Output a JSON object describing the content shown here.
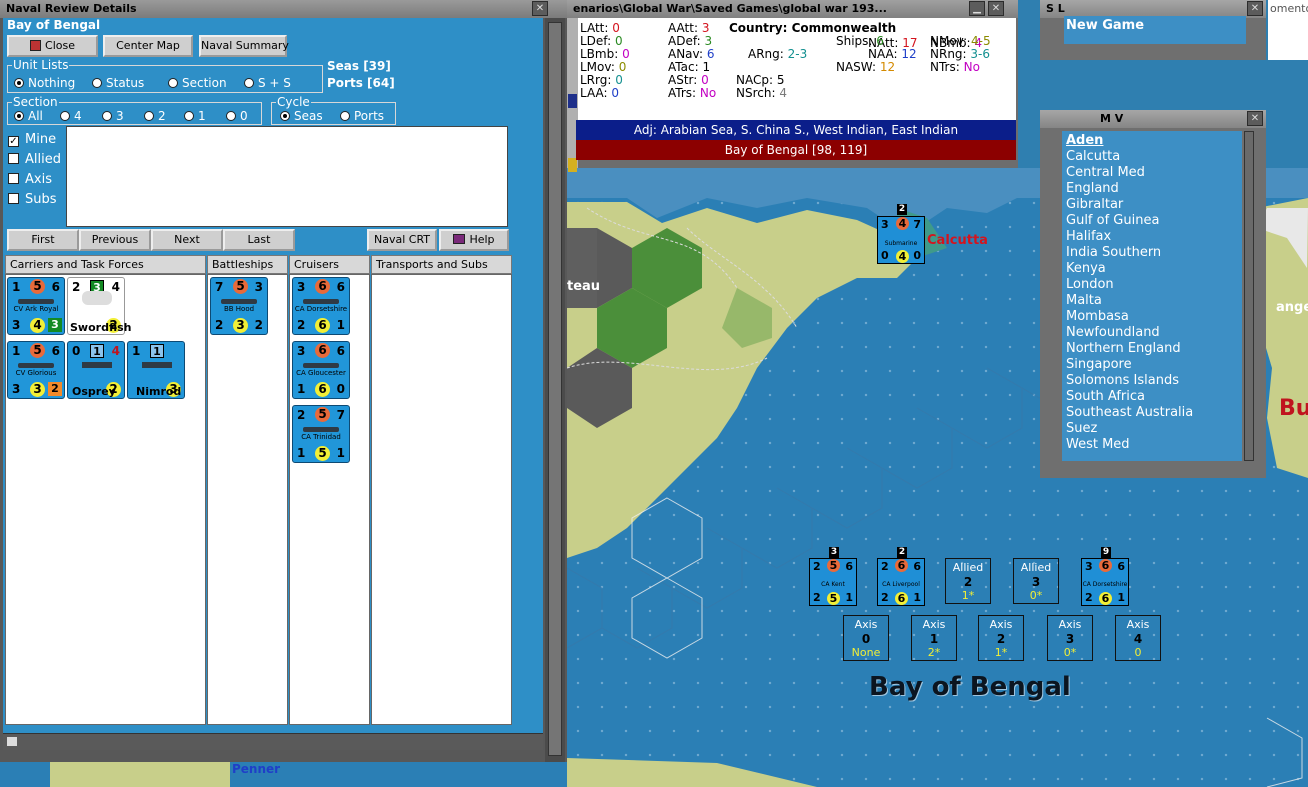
{
  "naval_review": {
    "title": "Naval Review Details",
    "sea_area": "Bay of Bengal",
    "buttons": {
      "close": "Close",
      "center_map": "Center Map",
      "naval_summary": "Naval Summary"
    },
    "seas": "Seas [39]",
    "ports": "Ports [64]",
    "unit_lists": {
      "title": "Unit Lists",
      "options": [
        "Nothing",
        "Status",
        "Section",
        "S + S"
      ],
      "selected": "Nothing"
    },
    "section": {
      "title": "Section",
      "options": [
        "All",
        "4",
        "3",
        "2",
        "1",
        "0"
      ],
      "selected": "All"
    },
    "cycle": {
      "title": "Cycle",
      "options": [
        "Seas",
        "Ports"
      ],
      "selected": "Seas"
    },
    "filters": [
      {
        "label": "Mine",
        "checked": true
      },
      {
        "label": "Allied",
        "checked": false
      },
      {
        "label": "Axis",
        "checked": false
      },
      {
        "label": "Subs",
        "checked": false
      }
    ],
    "nav": {
      "first": "First",
      "previous": "Previous",
      "next": "Next",
      "last": "Last",
      "naval_crt": "Naval CRT",
      "help": "Help"
    },
    "columns": [
      "Carriers and Task Forces",
      "Battleships",
      "Cruisers",
      "Transports and Subs"
    ],
    "carriers": [
      {
        "name": "CV Ark Royal",
        "tl": "1",
        "tc": "5",
        "tr": "6",
        "bl": "3",
        "bc": "4",
        "br": "3"
      },
      {
        "name": "CV Glorious",
        "tl": "1",
        "tc": "5",
        "tr": "6",
        "bl": "3",
        "bc": "3",
        "br": "2"
      }
    ],
    "aircraft": [
      {
        "label": "Swordfish",
        "tl": "2",
        "badge": "3",
        "tr": "4",
        "bc": "2"
      },
      {
        "label": "Osprey",
        "tl": "0",
        "badge": "1",
        "tr": "4",
        "bc": "2"
      },
      {
        "label": "Nimrod",
        "tl": "1",
        "badge": "1",
        "tr": "",
        "bc": "3"
      }
    ],
    "battleships": [
      {
        "name": "BB Hood",
        "tl": "7",
        "tc": "5",
        "tr": "3",
        "bl": "2",
        "bc": "3",
        "br": "2"
      }
    ],
    "cruisers": [
      {
        "name": "CA Dorsetshire",
        "tl": "3",
        "tc": "6",
        "tr": "6",
        "bl": "2",
        "bc": "6",
        "br": "1"
      },
      {
        "name": "CA Gloucester",
        "tl": "3",
        "tc": "6",
        "tr": "6",
        "bl": "1",
        "bc": "6",
        "br": "0"
      },
      {
        "name": "CA Trinidad",
        "tl": "2",
        "tc": "5",
        "tr": "7",
        "bl": "1",
        "bc": "5",
        "br": "1"
      }
    ]
  },
  "info_panel": {
    "title": "enarios\\Global War\\Saved Games\\global war 193...",
    "country": "Country: Commonwealth",
    "stats": [
      {
        "k": "LAtt:",
        "v": "0",
        "c": "#d4141e"
      },
      {
        "k": "AAtt:",
        "v": "3",
        "c": "#d4141e"
      },
      {
        "k": "NAtt:",
        "v": "17",
        "c": "#d4141e"
      },
      {
        "k": "NBmb:",
        "v": "4",
        "c": "#c200c2"
      },
      {
        "k": "LDef:",
        "v": "0",
        "c": "#2a8a22"
      },
      {
        "k": "ADef:",
        "v": "3",
        "c": "#2a8a22"
      },
      {
        "k": "Ships:",
        "v": "6",
        "c": "#2a8a22"
      },
      {
        "k": "NMov:",
        "v": "4-5",
        "c": "#8c8c00"
      },
      {
        "k": "LBmb:",
        "v": "0",
        "c": "#c200c2"
      },
      {
        "k": "ANav:",
        "v": "6",
        "c": "#1f3fc8"
      },
      {
        "k": "ARng:",
        "v": "2-3",
        "c": "#139090"
      },
      {
        "k": "NAA:",
        "v": "12",
        "c": "#1f3fc8"
      },
      {
        "k": "NRng:",
        "v": "3-6",
        "c": "#139090"
      },
      {
        "k": "LMov:",
        "v": "0",
        "c": "#8c8c00"
      },
      {
        "k": "ATac:",
        "v": "1",
        "c": "#000000"
      },
      {
        "k": "NASW:",
        "v": "12",
        "c": "#d48a00"
      },
      {
        "k": "NTrs:",
        "v": "No",
        "c": "#c200c2"
      },
      {
        "k": "LRrg:",
        "v": "0",
        "c": "#139090"
      },
      {
        "k": "AStr:",
        "v": "0",
        "c": "#c200c2"
      },
      {
        "k": "NACp:",
        "v": "5",
        "c": "#000000"
      },
      {
        "k": "LAA:",
        "v": "0",
        "c": "#1f3fc8"
      },
      {
        "k": "ATrs:",
        "v": "No",
        "c": "#c200c2"
      },
      {
        "k": "NSrch:",
        "v": "4",
        "c": "#7a7a7a"
      }
    ],
    "adjacent": "Adj: Arabian Sea, S. China S., West Indian, East Indian",
    "location": "Bay of Bengal [98, 119]"
  },
  "sl_window": {
    "title": "S L",
    "items": [
      "New Game"
    ]
  },
  "mv_window": {
    "title": "M V",
    "items": [
      "Aden",
      "Calcutta",
      "Central Med",
      "England",
      "Gibraltar",
      "Gulf of Guinea",
      "Halifax",
      "India Southern",
      "Kenya",
      "London",
      "Malta",
      "Mombasa",
      "Newfoundland",
      "Northern England",
      "Singapore",
      "Solomons Islands",
      "South Africa",
      "Southeast Australia",
      "Suez",
      "West Med"
    ],
    "selected": "Aden"
  },
  "map": {
    "sea_label": "Bay of Bengal",
    "city": "Calcutta",
    "plateau": "teau",
    "bottom_label": "Penner",
    "right_label": "ange",
    "right_red": "Bu",
    "submarine": {
      "name": "Submarine",
      "tl": "3",
      "tc": "4",
      "tr": "7",
      "bl": "0",
      "bc": "4",
      "br": "0",
      "flag": "2"
    },
    "stacks": [
      {
        "name": "CA Kent",
        "flag": "3",
        "tl": "2",
        "tc": "5",
        "tr": "6",
        "bl": "2",
        "bc": "5",
        "br": "1"
      },
      {
        "name": "CA Liverpool",
        "flag": "2",
        "tl": "2",
        "tc": "6",
        "tr": "6",
        "bl": "2",
        "bc": "6",
        "br": "1"
      },
      {
        "name": "CA Dorsetshire",
        "flag": "9",
        "tl": "3",
        "tc": "6",
        "tr": "6",
        "bl": "2",
        "bc": "6",
        "br": "1"
      }
    ],
    "allied_boxes": [
      {
        "label": "Allied",
        "num": "2",
        "sub": "1*"
      },
      {
        "label": "Allied",
        "num": "3",
        "sub": "0*"
      }
    ],
    "axis_boxes": [
      {
        "label": "Axis",
        "num": "0",
        "sub": "None"
      },
      {
        "label": "Axis",
        "num": "1",
        "sub": "2*"
      },
      {
        "label": "Axis",
        "num": "2",
        "sub": "1*"
      },
      {
        "label": "Axis",
        "num": "3",
        "sub": "0*"
      },
      {
        "label": "Axis",
        "num": "4",
        "sub": "0"
      }
    ]
  },
  "bg_text": "omento-"
}
